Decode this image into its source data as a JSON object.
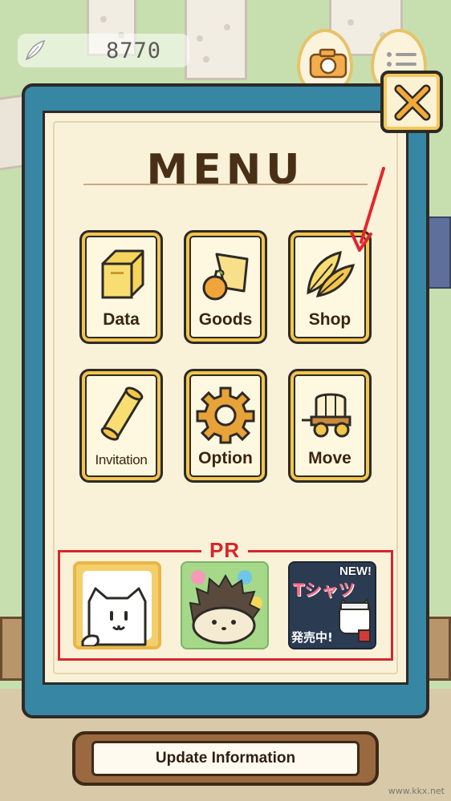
{
  "currency": {
    "icon": "feather-icon",
    "value": "8770"
  },
  "top_buttons": [
    {
      "icon": "camera-icon"
    },
    {
      "icon": "list-icon"
    }
  ],
  "menu": {
    "title": "MENU",
    "close_icon": "close-icon",
    "items": [
      {
        "label": "Data",
        "icon": "book-icon"
      },
      {
        "label": "Goods",
        "icon": "goods-icon"
      },
      {
        "label": "Shop",
        "icon": "feathers-icon"
      },
      {
        "label": "Invitation",
        "icon": "scroll-icon"
      },
      {
        "label": "Option",
        "icon": "gear-icon"
      },
      {
        "label": "Move",
        "icon": "wagon-icon"
      }
    ]
  },
  "pr": {
    "label": "PR",
    "ads": [
      {
        "icon": "cat-face-icon"
      },
      {
        "icon": "hedgehog-icon"
      },
      {
        "badge": "NEW!",
        "headline": "Tシャツ",
        "footer": "発売中!"
      }
    ]
  },
  "update": {
    "label": "Update Information"
  },
  "watermark": "www.kkx.net",
  "colors": {
    "panel": "#3786a4",
    "paper": "#faf1d9",
    "accent": "#f2c54e",
    "pr_red": "#d7262b"
  }
}
